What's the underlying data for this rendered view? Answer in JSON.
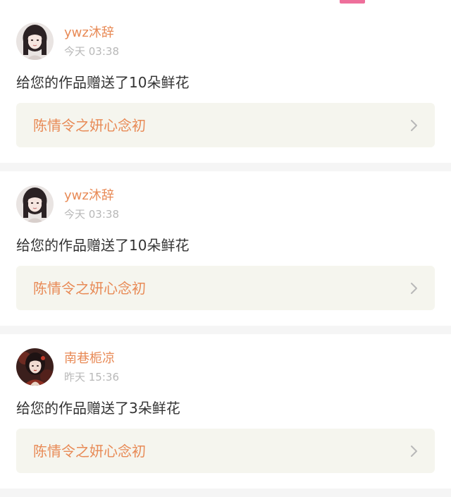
{
  "feed": [
    {
      "username": "ywz沐辞",
      "timestamp": "今天 03:38",
      "message": "给您的作品赠送了10朵鲜花",
      "work_title": "陈情令之妍心念初",
      "avatar_icon": "girl-portrait-icon"
    },
    {
      "username": "ywz沐辞",
      "timestamp": "今天 03:38",
      "message": "给您的作品赠送了10朵鲜花",
      "work_title": "陈情令之妍心念初",
      "avatar_icon": "girl-portrait-icon"
    },
    {
      "username": "南巷栀凉",
      "timestamp": "昨天 15:36",
      "message": "给您的作品赠送了3朵鲜花",
      "work_title": "陈情令之妍心念初",
      "avatar_icon": "costume-portrait-icon"
    }
  ],
  "colors": {
    "accent": "#e88a56",
    "tab_indicator": "#ee6f9b",
    "link_card_bg": "#f5f5ee",
    "timestamp": "#b8b8b8",
    "message_text": "#333333",
    "divider": "#f5f5f5"
  }
}
